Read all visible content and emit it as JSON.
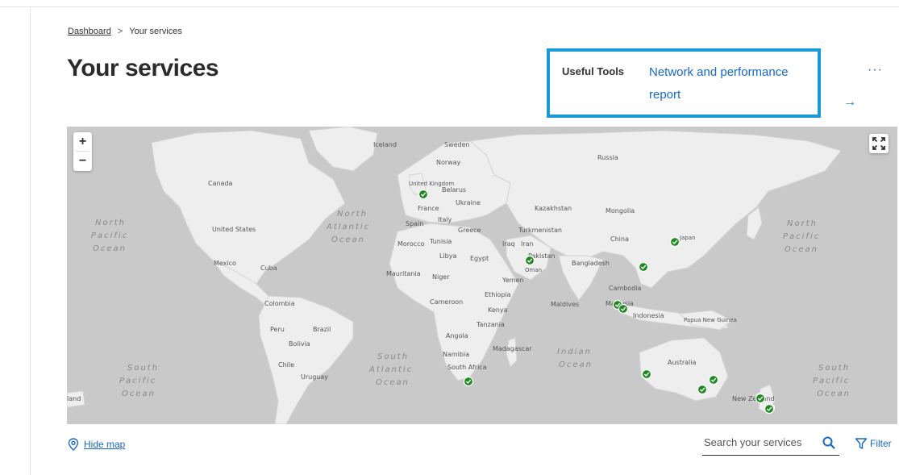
{
  "breadcrumb": {
    "home": "Dashboard",
    "separator": ">",
    "current": "Your services"
  },
  "page_title": "Your services",
  "useful_tools": {
    "label": "Useful Tools",
    "link_line1": "Network and performance",
    "link_line2": "report",
    "arrow": "→",
    "more": "···"
  },
  "map": {
    "zoom_in": "+",
    "zoom_out": "−",
    "countries": [
      "Canada",
      "United States",
      "Mexico",
      "Cuba",
      "Colombia",
      "Peru",
      "Brazil",
      "Bolivia",
      "Chile",
      "Uruguay",
      "Iceland",
      "Sweden",
      "Norway",
      "United Kingdom",
      "France",
      "Spain",
      "Italy",
      "Belarus",
      "Ukraine",
      "Greece",
      "Morocco",
      "Tunisia",
      "Libya",
      "Egypt",
      "Mauritania",
      "Niger",
      "Cameroon",
      "Ethiopia",
      "Kenya",
      "Tanzania",
      "Angola",
      "Namibia",
      "South Africa",
      "Madagascar",
      "Yemen",
      "Oman",
      "Iraq",
      "Iran",
      "Turkmenistan",
      "Kazakhstan",
      "Pakistan",
      "Russia",
      "Mongolia",
      "China",
      "Japan",
      "Bangladesh",
      "Cambodia",
      "Malaysia",
      "Indonesia",
      "Papua New Guinea",
      "Maldives",
      "Australia",
      "New Zealand"
    ],
    "oceans": {
      "north_pacific_left": [
        "North",
        "Pacific",
        "Ocean"
      ],
      "north_atlantic": [
        "North",
        "Atlantic",
        "Ocean"
      ],
      "north_pacific_right": [
        "North",
        "Pacific",
        "Ocean"
      ],
      "south_pacific_left": [
        "South",
        "Pacific",
        "Ocean"
      ],
      "south_atlantic": [
        "South",
        "Atlantic",
        "Ocean"
      ],
      "indian": [
        "Indian",
        "Ocean"
      ],
      "south_pacific_right": [
        "South",
        "Pacific",
        "Ocean"
      ]
    },
    "edge_label": "land",
    "service_marker_color": "#1f8a1f",
    "service_count": 14
  },
  "controls": {
    "hide_map": "Hide map",
    "search_placeholder": "Search your services",
    "filter": "Filter"
  },
  "colors": {
    "accent": "#1769c5",
    "highlight_border": "#1a9ad9",
    "map_water": "#c9c9c9",
    "map_land": "#eeeeee"
  }
}
